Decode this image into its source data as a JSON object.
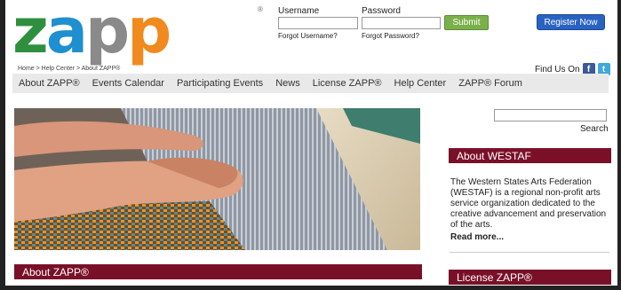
{
  "logo": {
    "letters": [
      "z",
      "a",
      "p",
      "p"
    ],
    "colors": [
      "#2e8f3e",
      "#1f8fcf",
      "#8a8a8a",
      "#f08a1e"
    ],
    "trademark": "®"
  },
  "login": {
    "username_label": "Username",
    "password_label": "Password",
    "username_value": "",
    "password_value": "",
    "forgot_username": "Forgot Username?",
    "forgot_password": "Forgot Password?",
    "submit_label": "Submit"
  },
  "register_label": "Register Now",
  "breadcrumb": "Home > Help Center > About ZAPP®",
  "find_us": {
    "label": "Find Us On",
    "facebook": "f",
    "twitter": "t"
  },
  "nav": [
    "About ZAPP®",
    "Events Calendar",
    "Participating Events",
    "News",
    "License ZAPP®",
    "Help Center",
    "ZAPP® Forum"
  ],
  "main": {
    "section_title": "About ZAPP®"
  },
  "sidebar": {
    "search_value": "",
    "search_label": "Search",
    "westaf_title": "About WESTAF",
    "westaf_text": "The Western States Arts Federation (WESTAF) is a regional non-profit arts service organization dedicated to the creative advancement and preservation of the arts.",
    "read_more": "Read more...",
    "license_title": "License ZAPP®"
  },
  "colors": {
    "section_bar": "#7a1028",
    "submit": "#7ab04a",
    "register": "#2a62c2",
    "nav_bg": "#e9e9e9"
  }
}
